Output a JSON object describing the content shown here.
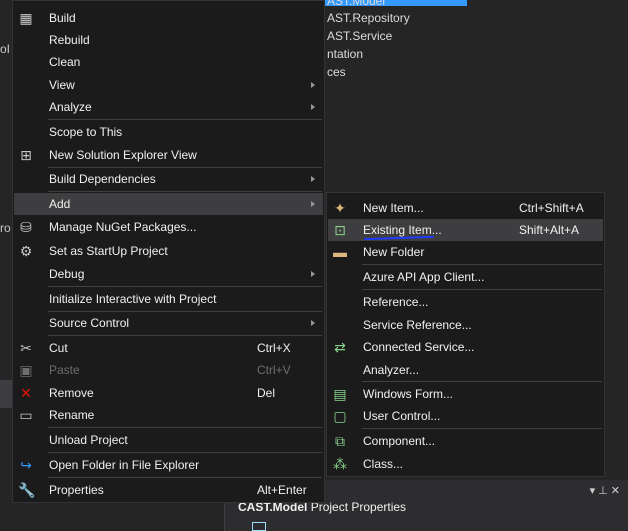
{
  "background": {
    "left_fragments": [
      "oI",
      "ro"
    ],
    "tree_items": [
      "AST.Model",
      "AST.Repository",
      "AST.Service",
      "ntation",
      "ces"
    ],
    "properties_panel": {
      "project_name": "CAST.Model",
      "title_suffix": "Project Properties"
    }
  },
  "context_menu": {
    "items": [
      {
        "label": "Build",
        "icon": "build-icon"
      },
      {
        "label": "Rebuild"
      },
      {
        "label": "Clean"
      },
      {
        "label": "View",
        "submenu": true
      },
      {
        "label": "Analyze",
        "submenu": true
      },
      {
        "label": "Scope to This"
      },
      {
        "label": "New Solution Explorer View",
        "icon": "new-solution-explorer-view-icon"
      },
      {
        "label": "Build Dependencies",
        "submenu": true
      },
      {
        "label": "Add",
        "submenu": true,
        "highlighted": true
      },
      {
        "label": "Manage NuGet Packages...",
        "icon": "nuget-icon"
      },
      {
        "label": "Set as StartUp Project",
        "icon": "gear-icon"
      },
      {
        "label": "Debug",
        "submenu": true
      },
      {
        "label": "Initialize Interactive with Project"
      },
      {
        "label": "Source Control",
        "submenu": true
      },
      {
        "label": "Cut",
        "shortcut": "Ctrl+X",
        "icon": "scissors-icon"
      },
      {
        "label": "Paste",
        "shortcut": "Ctrl+V",
        "icon": "paste-icon",
        "disabled": true
      },
      {
        "label": "Remove",
        "shortcut": "Del",
        "icon": "remove-icon"
      },
      {
        "label": "Rename",
        "icon": "rename-icon"
      },
      {
        "label": "Unload Project"
      },
      {
        "label": "Open Folder in File Explorer",
        "icon": "open-folder-icon"
      },
      {
        "label": "Properties",
        "shortcut": "Alt+Enter",
        "icon": "wrench-icon"
      }
    ]
  },
  "add_submenu": {
    "items": [
      {
        "label": "New Item...",
        "shortcut": "Ctrl+Shift+A",
        "icon": "new-item-icon"
      },
      {
        "label": "Existing Item...",
        "shortcut": "Shift+Alt+A",
        "icon": "existing-item-icon",
        "highlighted": true
      },
      {
        "label": "New Folder",
        "icon": "new-folder-icon"
      },
      {
        "label": "Azure API App Client..."
      },
      {
        "label": "Reference..."
      },
      {
        "label": "Service Reference..."
      },
      {
        "label": "Connected Service...",
        "icon": "connected-service-icon"
      },
      {
        "label": "Analyzer..."
      },
      {
        "label": "Windows Form...",
        "icon": "windows-form-icon"
      },
      {
        "label": "User Control...",
        "icon": "user-control-icon"
      },
      {
        "label": "Component...",
        "icon": "component-icon"
      },
      {
        "label": "Class...",
        "icon": "class-icon"
      }
    ]
  },
  "colors": {
    "menu_background": "#1b1b1c",
    "highlight": "#3e3e40",
    "selection_accent": "#3399ff",
    "annotation_underline": "#1f3bff"
  }
}
